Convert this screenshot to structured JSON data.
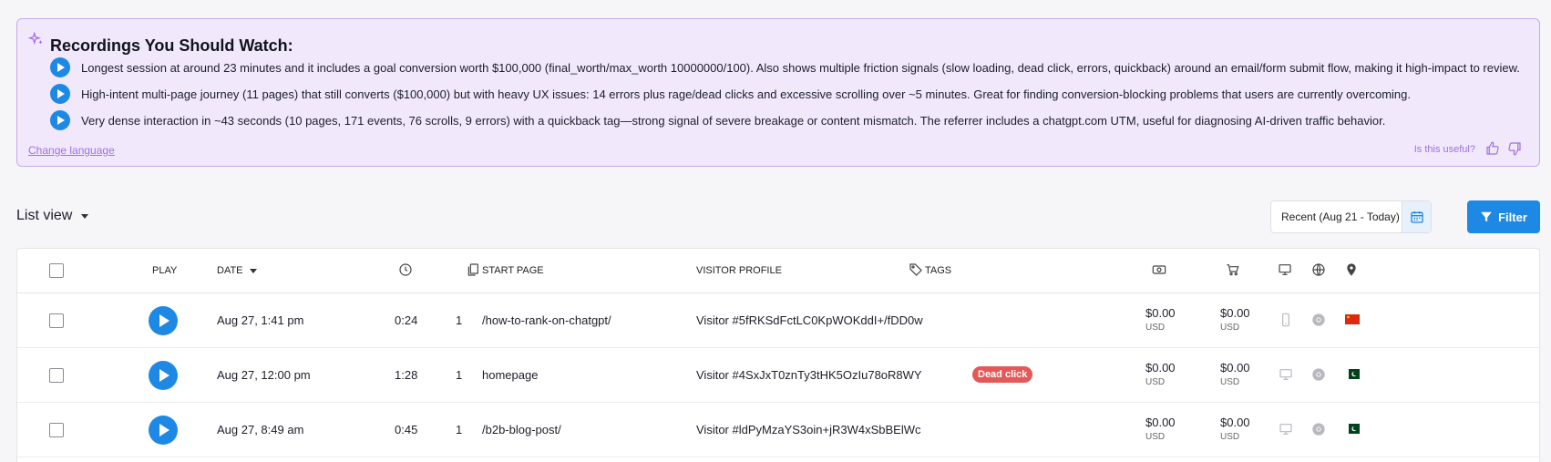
{
  "ai_panel": {
    "title": "Recordings You Should Watch:",
    "items": [
      "Longest session at around 23 minutes and it includes a goal conversion worth $100,000 (final_worth/max_worth 10000000/100). Also shows multiple friction signals (slow loading, dead click, errors, quickback) around an email/form submit flow, making it high-impact to review.",
      "High-intent multi-page journey (11 pages) that still converts ($100,000) but with heavy UX issues: 14 errors plus rage/dead clicks and excessive scrolling over ~5 minutes. Great for finding conversion-blocking problems that users are currently overcoming.",
      "Very dense interaction in ~43 seconds (10 pages, 171 events, 76 scrolls, 9 errors) with a quickback tag—strong signal of severe breakage or content mismatch. The referrer includes a chatgpt.com UTM, useful for diagnosing AI-driven traffic behavior."
    ],
    "change_language": "Change language",
    "useful_label": "Is this useful?"
  },
  "toolbar": {
    "list_view": "List view",
    "date_range": "Recent (Aug 21 - Today)",
    "filter": "Filter"
  },
  "table": {
    "headers": {
      "play": "PLAY",
      "date": "DATE",
      "start_page": "START PAGE",
      "visitor_profile": "VISITOR PROFILE",
      "tags": "TAGS"
    },
    "rows": [
      {
        "date": "Aug 27, 1:41 pm",
        "duration": "0:24",
        "pages": "1",
        "start_page": "/how-to-rank-on-chatgpt/",
        "visitor": "Visitor #5fRKSdFctLC0KpWOKddI+/fDD0w",
        "tag": "",
        "revenue": "$0.00",
        "revenue_currency": "USD",
        "cart": "$0.00",
        "cart_currency": "USD",
        "device": "mobile-icon",
        "flag": "china"
      },
      {
        "date": "Aug 27, 12:00 pm",
        "duration": "1:28",
        "pages": "1",
        "start_page": "homepage",
        "visitor": "Visitor #4SxJxT0znTy3tHK5OzIu78oR8WY",
        "tag": "Dead click",
        "revenue": "$0.00",
        "revenue_currency": "USD",
        "cart": "$0.00",
        "cart_currency": "USD",
        "device": "desktop-icon",
        "flag": "pakistan"
      },
      {
        "date": "Aug 27, 8:49 am",
        "duration": "0:45",
        "pages": "1",
        "start_page": "/b2b-blog-post/",
        "visitor": "Visitor #ldPyMzaYS3oin+jR3W4xSbBElWc",
        "tag": "",
        "revenue": "$0.00",
        "revenue_currency": "USD",
        "cart": "$0.00",
        "cart_currency": "USD",
        "device": "desktop-icon",
        "flag": "pakistan"
      }
    ]
  },
  "colors": {
    "accent": "#1e88e5",
    "ai_bg": "#f1e9fb",
    "ai_border": "#c6a9ee",
    "tag_red": "#e45858"
  }
}
